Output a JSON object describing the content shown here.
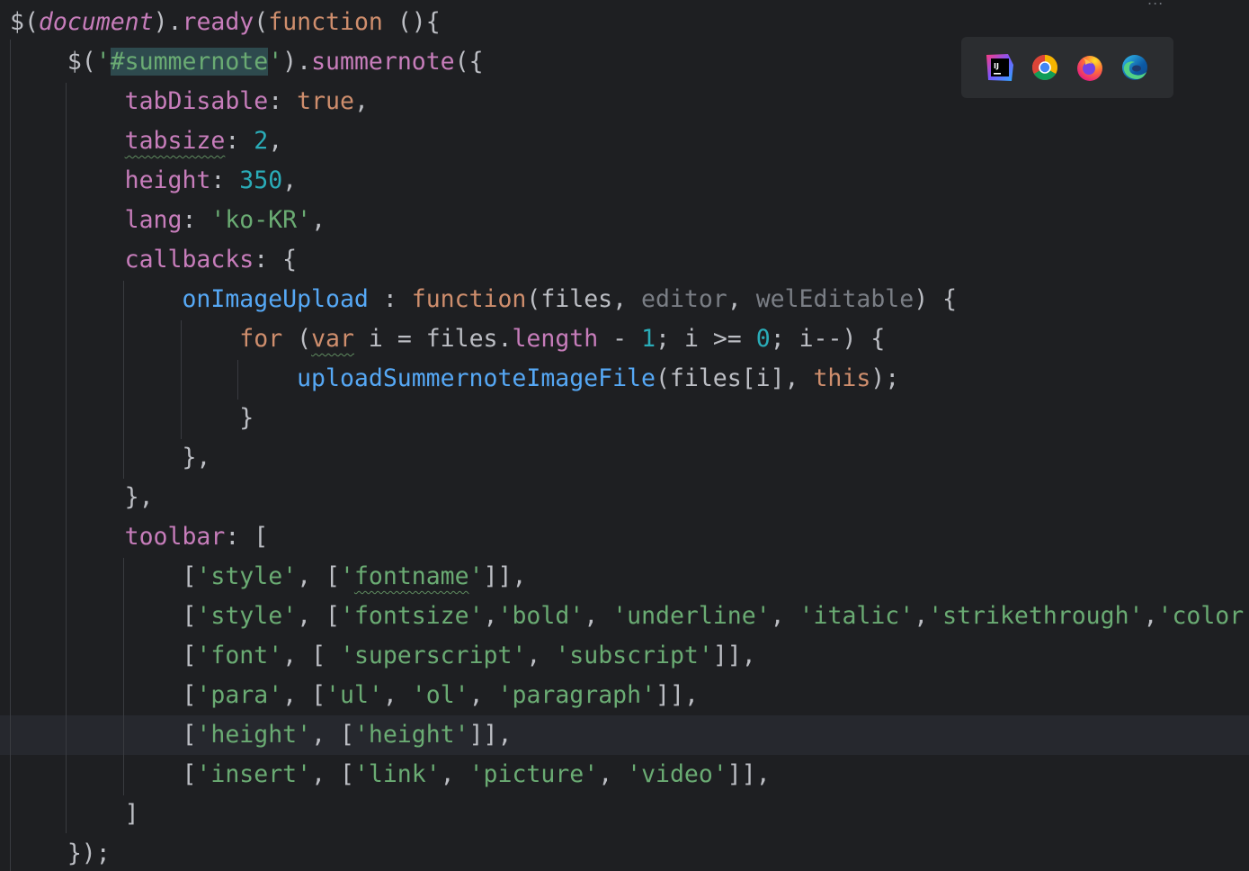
{
  "editor": {
    "language": "javascript",
    "current_line_index": 18,
    "lines": [
      [
        {
          "t": "$(",
          "c": "plain"
        },
        {
          "t": "document",
          "c": "prop ital"
        },
        {
          "t": ").",
          "c": "plain"
        },
        {
          "t": "ready",
          "c": "prop"
        },
        {
          "t": "(",
          "c": "plain"
        },
        {
          "t": "function",
          "c": "kw"
        },
        {
          "t": " (){",
          "c": "plain"
        }
      ],
      [
        {
          "t": "    $(",
          "c": "plain"
        },
        {
          "t": "'",
          "c": "str"
        },
        {
          "t": "#summernote",
          "c": "str sel"
        },
        {
          "t": "'",
          "c": "str"
        },
        {
          "t": ").",
          "c": "plain"
        },
        {
          "t": "summernote",
          "c": "prop"
        },
        {
          "t": "({",
          "c": "plain"
        }
      ],
      [
        {
          "t": "        ",
          "c": "plain"
        },
        {
          "t": "tabDisable",
          "c": "prop"
        },
        {
          "t": ": ",
          "c": "plain"
        },
        {
          "t": "true",
          "c": "kw"
        },
        {
          "t": ",",
          "c": "plain"
        }
      ],
      [
        {
          "t": "        ",
          "c": "plain"
        },
        {
          "t": "tabsize",
          "c": "prop warn"
        },
        {
          "t": ": ",
          "c": "plain"
        },
        {
          "t": "2",
          "c": "num"
        },
        {
          "t": ",",
          "c": "plain"
        }
      ],
      [
        {
          "t": "        ",
          "c": "plain"
        },
        {
          "t": "height",
          "c": "prop"
        },
        {
          "t": ": ",
          "c": "plain"
        },
        {
          "t": "350",
          "c": "num"
        },
        {
          "t": ",",
          "c": "plain"
        }
      ],
      [
        {
          "t": "        ",
          "c": "plain"
        },
        {
          "t": "lang",
          "c": "prop"
        },
        {
          "t": ": ",
          "c": "plain"
        },
        {
          "t": "'ko-KR'",
          "c": "str"
        },
        {
          "t": ",",
          "c": "plain"
        }
      ],
      [
        {
          "t": "        ",
          "c": "plain"
        },
        {
          "t": "callbacks",
          "c": "prop"
        },
        {
          "t": ": {",
          "c": "plain"
        }
      ],
      [
        {
          "t": "            ",
          "c": "plain"
        },
        {
          "t": "onImageUpload",
          "c": "fn"
        },
        {
          "t": " : ",
          "c": "plain"
        },
        {
          "t": "function",
          "c": "kw"
        },
        {
          "t": "(files, ",
          "c": "plain"
        },
        {
          "t": "editor",
          "c": "param"
        },
        {
          "t": ", ",
          "c": "plain"
        },
        {
          "t": "welEditable",
          "c": "param"
        },
        {
          "t": ") {",
          "c": "plain"
        }
      ],
      [
        {
          "t": "                ",
          "c": "plain"
        },
        {
          "t": "for",
          "c": "kw"
        },
        {
          "t": " (",
          "c": "plain"
        },
        {
          "t": "var",
          "c": "kw warn"
        },
        {
          "t": " i = files.",
          "c": "plain"
        },
        {
          "t": "length",
          "c": "prop"
        },
        {
          "t": " - ",
          "c": "plain"
        },
        {
          "t": "1",
          "c": "num"
        },
        {
          "t": "; i >= ",
          "c": "plain"
        },
        {
          "t": "0",
          "c": "num"
        },
        {
          "t": "; i--) {",
          "c": "plain"
        }
      ],
      [
        {
          "t": "                    ",
          "c": "plain"
        },
        {
          "t": "uploadSummernoteImageFile",
          "c": "fn"
        },
        {
          "t": "(files[i], ",
          "c": "plain"
        },
        {
          "t": "this",
          "c": "kw"
        },
        {
          "t": ");",
          "c": "plain"
        }
      ],
      [
        {
          "t": "                }",
          "c": "plain"
        }
      ],
      [
        {
          "t": "            },",
          "c": "plain"
        }
      ],
      [
        {
          "t": "        },",
          "c": "plain"
        }
      ],
      [
        {
          "t": "        ",
          "c": "plain"
        },
        {
          "t": "toolbar",
          "c": "prop"
        },
        {
          "t": ": [",
          "c": "plain"
        }
      ],
      [
        {
          "t": "            [",
          "c": "plain"
        },
        {
          "t": "'style'",
          "c": "str"
        },
        {
          "t": ", [",
          "c": "plain"
        },
        {
          "t": "'",
          "c": "str"
        },
        {
          "t": "fontname",
          "c": "str warn"
        },
        {
          "t": "'",
          "c": "str"
        },
        {
          "t": "]],",
          "c": "plain"
        }
      ],
      [
        {
          "t": "            [",
          "c": "plain"
        },
        {
          "t": "'style'",
          "c": "str"
        },
        {
          "t": ", [",
          "c": "plain"
        },
        {
          "t": "'fontsize'",
          "c": "str"
        },
        {
          "t": ",",
          "c": "plain"
        },
        {
          "t": "'bold'",
          "c": "str"
        },
        {
          "t": ", ",
          "c": "plain"
        },
        {
          "t": "'underline'",
          "c": "str"
        },
        {
          "t": ", ",
          "c": "plain"
        },
        {
          "t": "'italic'",
          "c": "str"
        },
        {
          "t": ",",
          "c": "plain"
        },
        {
          "t": "'strikethrough'",
          "c": "str"
        },
        {
          "t": ",",
          "c": "plain"
        },
        {
          "t": "'color",
          "c": "str"
        }
      ],
      [
        {
          "t": "            [",
          "c": "plain"
        },
        {
          "t": "'font'",
          "c": "str"
        },
        {
          "t": ", [ ",
          "c": "plain"
        },
        {
          "t": "'superscript'",
          "c": "str"
        },
        {
          "t": ", ",
          "c": "plain"
        },
        {
          "t": "'subscript'",
          "c": "str"
        },
        {
          "t": "]],",
          "c": "plain"
        }
      ],
      [
        {
          "t": "            [",
          "c": "plain"
        },
        {
          "t": "'para'",
          "c": "str"
        },
        {
          "t": ", [",
          "c": "plain"
        },
        {
          "t": "'ul'",
          "c": "str"
        },
        {
          "t": ", ",
          "c": "plain"
        },
        {
          "t": "'ol'",
          "c": "str"
        },
        {
          "t": ", ",
          "c": "plain"
        },
        {
          "t": "'paragraph'",
          "c": "str"
        },
        {
          "t": "]],",
          "c": "plain"
        }
      ],
      [
        {
          "t": "            [",
          "c": "plain"
        },
        {
          "t": "'height'",
          "c": "str"
        },
        {
          "t": ", [",
          "c": "plain"
        },
        {
          "t": "'height'",
          "c": "str"
        },
        {
          "t": "]],",
          "c": "plain"
        }
      ],
      [
        {
          "t": "            [",
          "c": "plain"
        },
        {
          "t": "'insert'",
          "c": "str"
        },
        {
          "t": ", [",
          "c": "plain"
        },
        {
          "t": "'link'",
          "c": "str"
        },
        {
          "t": ", ",
          "c": "plain"
        },
        {
          "t": "'picture'",
          "c": "str"
        },
        {
          "t": ", ",
          "c": "plain"
        },
        {
          "t": "'video'",
          "c": "str"
        },
        {
          "t": "]],",
          "c": "plain"
        }
      ],
      [
        {
          "t": "        ]",
          "c": "plain"
        }
      ],
      [
        {
          "t": "    });",
          "c": "plain"
        }
      ]
    ]
  },
  "browser_popup": {
    "icons": [
      {
        "name": "intellij-idea-icon"
      },
      {
        "name": "chrome-icon"
      },
      {
        "name": "firefox-icon"
      },
      {
        "name": "edge-icon"
      }
    ]
  },
  "overflow_indicator": "...",
  "colors": {
    "background": "#1e1f22",
    "current_line": "#26282e",
    "keyword": "#cf8e6d",
    "function": "#56a8f5",
    "string": "#6aab73",
    "number": "#2aacb8",
    "property": "#c77dbb",
    "unused_param": "#7a7e85",
    "plain": "#bcbec4"
  }
}
